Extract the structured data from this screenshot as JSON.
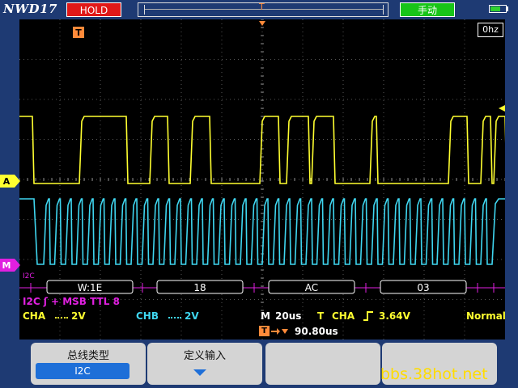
{
  "header": {
    "brand": "NWD17",
    "run_state": "HOLD",
    "trigger_marker": "T",
    "mode": "手动"
  },
  "display": {
    "frequency": "0hz",
    "trigger_icon": "T",
    "cha_marker": "A",
    "chb_marker": "M",
    "decode_label": "I2C",
    "decode_packets": [
      "W:1E",
      "18",
      "AC",
      "03"
    ],
    "colors": {
      "cha": "#ffff30",
      "chb": "#3fd6f0",
      "decode": "#e020e0",
      "trigger": "#ff8a3a"
    }
  },
  "status": {
    "decode_info": "I2C ʃ + MSB TTL 8",
    "cha_label": "CHA",
    "cha_scale": "2V",
    "chb_label": "CHB",
    "chb_scale": "2V",
    "timebase_label": "M",
    "timebase": "20us",
    "trigger_label": "T",
    "trigger_source": "CHA",
    "trigger_level": "3.64V",
    "acq_mode": "Normal",
    "trigger_offset": "90.80us"
  },
  "softkeys": {
    "bus_type_label": "总线类型",
    "bus_type_value": "I2C",
    "define_input_label": "定义输入"
  },
  "watermark": "bbs.38hot.net"
}
